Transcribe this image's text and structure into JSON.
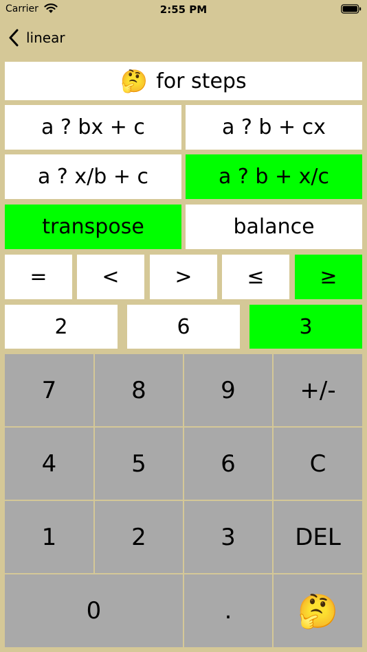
{
  "status_bar": {
    "carrier": "Carrier",
    "time": "2:55 PM"
  },
  "nav": {
    "back_label": "linear"
  },
  "steps": {
    "emoji": "🤔",
    "label": "for steps"
  },
  "forms": {
    "f1": "a ? bx + c",
    "f2": "a ? b + cx",
    "f3": "a ? x/b + c",
    "f4": "a ? b + x/c",
    "selected": "f4"
  },
  "methods": {
    "transpose": "transpose",
    "balance": "balance",
    "selected": "transpose"
  },
  "relations": {
    "eq": "=",
    "lt": "<",
    "gt": ">",
    "le": "≤",
    "ge": "≥",
    "selected": "ge"
  },
  "values": {
    "a": "2",
    "b": "6",
    "c": "3",
    "selected": "c"
  },
  "keypad": {
    "k7": "7",
    "k8": "8",
    "k9": "9",
    "plusminus": "+/-",
    "k4": "4",
    "k5": "5",
    "k6": "6",
    "clear": "C",
    "k1": "1",
    "k2": "2",
    "k3": "3",
    "del": "DEL",
    "k0": "0",
    "dot": ".",
    "think": "🤔"
  },
  "colors": {
    "background": "#d5c897",
    "selected": "#00ff00",
    "button": "#ffffff",
    "key": "#a9a9a9"
  }
}
